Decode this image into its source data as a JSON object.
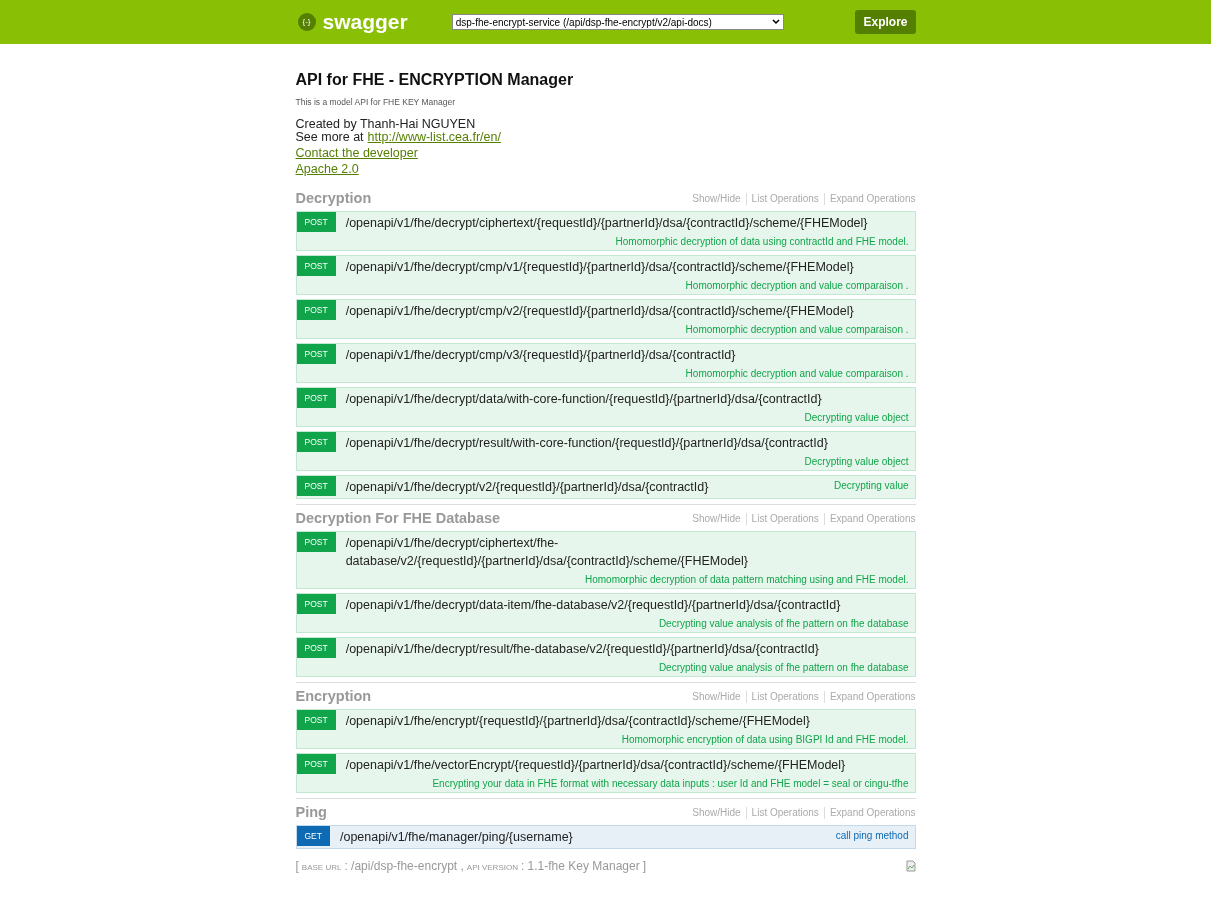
{
  "header": {
    "logo_text": "swagger",
    "logo_glyph": "{-}",
    "api_select": "dsp-fhe-encrypt-service (/api/dsp-fhe-encrypt/v2/api-docs)",
    "explore_button": "Explore"
  },
  "info": {
    "title": "API for FHE - ENCRYPTION Manager",
    "description": "This is a model API for FHE KEY Manager",
    "created_by": "Created by Thanh-Hai NGUYEN",
    "see_more_label": "See more at",
    "see_more_link": "http://www-list.cea.fr/en/",
    "contact_link": "Contact the developer",
    "license_link": "Apache 2.0"
  },
  "sections": [
    {
      "name": "Decryption",
      "actions": [
        "Show/Hide",
        "List Operations",
        "Expand Operations"
      ],
      "operations": [
        {
          "kind": "post",
          "method": "POST",
          "path": "/openapi/v1/fhe/decrypt/ciphertext/{requestId}/{partnerId}/dsa/{contractId}/scheme/{FHEModel}",
          "summary": "Homomorphic decryption of data using contractId and FHE model."
        },
        {
          "kind": "post",
          "method": "POST",
          "path": "/openapi/v1/fhe/decrypt/cmp/v1/{requestId}/{partnerId}/dsa/{contractId}/scheme/{FHEModel}",
          "summary": "Homomorphic decryption and value comparaison ."
        },
        {
          "kind": "post",
          "method": "POST",
          "path": "/openapi/v1/fhe/decrypt/cmp/v2/{requestId}/{partnerId}/dsa/{contractId}/scheme/{FHEModel}",
          "summary": "Homomorphic decryption and value comparaison ."
        },
        {
          "kind": "post",
          "method": "POST",
          "path": "/openapi/v1/fhe/decrypt/cmp/v3/{requestId}/{partnerId}/dsa/{contractId}",
          "summary": "Homomorphic decryption and value comparaison ."
        },
        {
          "kind": "post",
          "method": "POST",
          "path": "/openapi/v1/fhe/decrypt/data/with-core-function/{requestId}/{partnerId}/dsa/{contractId}",
          "summary": "Decrypting value object"
        },
        {
          "kind": "post",
          "method": "POST",
          "path": "/openapi/v1/fhe/decrypt/result/with-core-function/{requestId}/{partnerId}/dsa/{contractId}",
          "summary": "Decrypting value object"
        },
        {
          "kind": "post",
          "method": "POST",
          "path": "/openapi/v1/fhe/decrypt/v2/{requestId}/{partnerId}/dsa/{contractId}",
          "summary": "Decrypting value"
        }
      ]
    },
    {
      "name": "Decryption For FHE Database",
      "actions": [
        "Show/Hide",
        "List Operations",
        "Expand Operations"
      ],
      "operations": [
        {
          "kind": "post",
          "method": "POST",
          "path": "/openapi/v1/fhe/decrypt/ciphertext/fhe-database/v2/{requestId}/{partnerId}/dsa/{contractId}/scheme/{FHEModel}",
          "summary": "Homomorphic decryption of data pattern matching using and FHE model."
        },
        {
          "kind": "post",
          "method": "POST",
          "path": "/openapi/v1/fhe/decrypt/data-item/fhe-database/v2/{requestId}/{partnerId}/dsa/{contractId}",
          "summary": "Decrypting value analysis of fhe pattern on fhe database"
        },
        {
          "kind": "post",
          "method": "POST",
          "path": "/openapi/v1/fhe/decrypt/result/fhe-database/v2/{requestId}/{partnerId}/dsa/{contractId}",
          "summary": "Decrypting value analysis of fhe pattern on fhe database"
        }
      ]
    },
    {
      "name": "Encryption",
      "actions": [
        "Show/Hide",
        "List Operations",
        "Expand Operations"
      ],
      "operations": [
        {
          "kind": "post",
          "method": "POST",
          "path": "/openapi/v1/fhe/encrypt/{requestId}/{partnerId}/dsa/{contractId}/scheme/{FHEModel}",
          "summary": "Homomorphic encryption of data using BIGPI Id and FHE model."
        },
        {
          "kind": "post",
          "method": "POST",
          "path": "/openapi/v1/fhe/vectorEncrypt/{requestId}/{partnerId}/dsa/{contractId}/scheme/{FHEModel}",
          "summary": "Encrypting your data in FHE format with necessary data inputs : user Id and FHE model = seal or cingu-tfhe"
        }
      ]
    },
    {
      "name": "Ping",
      "actions": [
        "Show/Hide",
        "List Operations",
        "Expand Operations"
      ],
      "operations": [
        {
          "kind": "get",
          "method": "GET",
          "path": "/openapi/v1/fhe/manager/ping/{username}",
          "summary": "call ping method"
        }
      ]
    }
  ],
  "footer": {
    "open": "[",
    "base_url_label": "BASE URL",
    "base_url": ": /api/dsp-fhe-encrypt ,",
    "api_version_label": "API VERSION",
    "api_version": ": 1.1-fhe Key Manager",
    "close": "]"
  }
}
